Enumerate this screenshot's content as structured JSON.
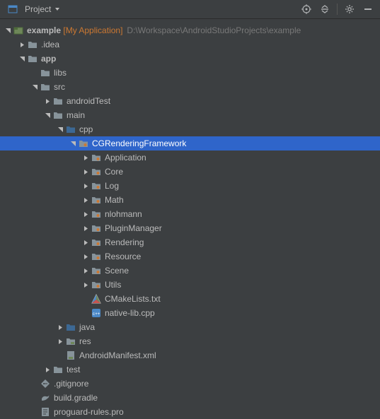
{
  "topbar": {
    "project_label": "Project"
  },
  "tree": {
    "root": {
      "name": "example",
      "bracket": "[My Application]",
      "path": "D:\\Workspace\\AndroidStudioProjects\\example"
    },
    "nodes": [
      {
        "indent": 1,
        "arrow": "right",
        "icon": "folder",
        "label": ".idea"
      },
      {
        "indent": 1,
        "arrow": "down",
        "icon": "folder",
        "label": "app",
        "bold": true
      },
      {
        "indent": 2,
        "arrow": "none",
        "icon": "folder",
        "label": "libs"
      },
      {
        "indent": 2,
        "arrow": "down",
        "icon": "folder",
        "label": "src"
      },
      {
        "indent": 3,
        "arrow": "right",
        "icon": "folder",
        "label": "androidTest"
      },
      {
        "indent": 3,
        "arrow": "down",
        "icon": "folder",
        "label": "main"
      },
      {
        "indent": 4,
        "arrow": "down",
        "icon": "folder-src",
        "label": "cpp"
      },
      {
        "indent": 5,
        "arrow": "down",
        "icon": "folder-pkg",
        "label": "CGRenderingFramework",
        "selected": true
      },
      {
        "indent": 6,
        "arrow": "right",
        "icon": "folder-pkg",
        "label": "Application"
      },
      {
        "indent": 6,
        "arrow": "right",
        "icon": "folder-pkg",
        "label": "Core"
      },
      {
        "indent": 6,
        "arrow": "right",
        "icon": "folder-pkg",
        "label": "Log"
      },
      {
        "indent": 6,
        "arrow": "right",
        "icon": "folder-pkg",
        "label": "Math"
      },
      {
        "indent": 6,
        "arrow": "right",
        "icon": "folder-pkg",
        "label": "nlohmann"
      },
      {
        "indent": 6,
        "arrow": "right",
        "icon": "folder-pkg",
        "label": "PluginManager"
      },
      {
        "indent": 6,
        "arrow": "right",
        "icon": "folder-pkg",
        "label": "Rendering"
      },
      {
        "indent": 6,
        "arrow": "right",
        "icon": "folder-pkg",
        "label": "Resource"
      },
      {
        "indent": 6,
        "arrow": "right",
        "icon": "folder-pkg",
        "label": "Scene"
      },
      {
        "indent": 6,
        "arrow": "right",
        "icon": "folder-pkg",
        "label": "Utils"
      },
      {
        "indent": 6,
        "arrow": "none",
        "icon": "cmake",
        "label": "CMakeLists.txt"
      },
      {
        "indent": 6,
        "arrow": "none",
        "icon": "cpp",
        "label": "native-lib.cpp"
      },
      {
        "indent": 4,
        "arrow": "right",
        "icon": "folder-src",
        "label": "java"
      },
      {
        "indent": 4,
        "arrow": "right",
        "icon": "folder-res",
        "label": "res"
      },
      {
        "indent": 4,
        "arrow": "none",
        "icon": "manifest",
        "label": "AndroidManifest.xml"
      },
      {
        "indent": 3,
        "arrow": "right",
        "icon": "folder",
        "label": "test"
      },
      {
        "indent": 2,
        "arrow": "none",
        "icon": "gitignore",
        "label": ".gitignore"
      },
      {
        "indent": 2,
        "arrow": "none",
        "icon": "gradle",
        "label": "build.gradle"
      },
      {
        "indent": 2,
        "arrow": "none",
        "icon": "proguard",
        "label": "proguard-rules.pro"
      }
    ]
  }
}
